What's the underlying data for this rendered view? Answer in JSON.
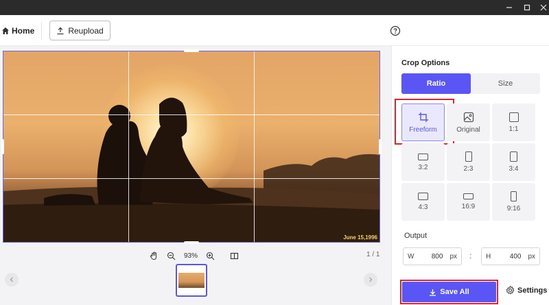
{
  "toolbar": {
    "home_label": "Home",
    "reupload_label": "Reupload"
  },
  "canvas": {
    "date_stamp": "June 15,1996",
    "zoom": "93%",
    "page_count": "1 / 1"
  },
  "panel": {
    "title": "Crop Options",
    "tabs": [
      "Ratio",
      "Size"
    ],
    "active_tab": "Ratio",
    "ratios": [
      {
        "label": "Freeform",
        "icon": "crop-icon",
        "selected": true
      },
      {
        "label": "Original",
        "icon": "image-icon",
        "selected": false
      },
      {
        "label": "1:1",
        "icon": "square-shape-icon",
        "selected": false
      },
      {
        "label": "3:2",
        "icon": "landscape-shape-icon",
        "selected": false
      },
      {
        "label": "2:3",
        "icon": "portrait-shape-icon",
        "selected": false
      },
      {
        "label": "3:4",
        "icon": "portrait-shape-icon",
        "selected": false
      },
      {
        "label": "4:3",
        "icon": "landscape-shape-icon",
        "selected": false
      },
      {
        "label": "16:9",
        "icon": "wide-shape-icon",
        "selected": false
      },
      {
        "label": "9:16",
        "icon": "tall-shape-icon",
        "selected": false
      }
    ],
    "output": {
      "label": "Output",
      "width_prefix": "W",
      "width_value": "800",
      "height_prefix": "H",
      "height_value": "400",
      "unit": "px",
      "separator": ":"
    },
    "save_all_label": "Save All",
    "settings_label": "Settings"
  },
  "colors": {
    "accent": "#5a55f5",
    "highlight": "#d7262b"
  }
}
